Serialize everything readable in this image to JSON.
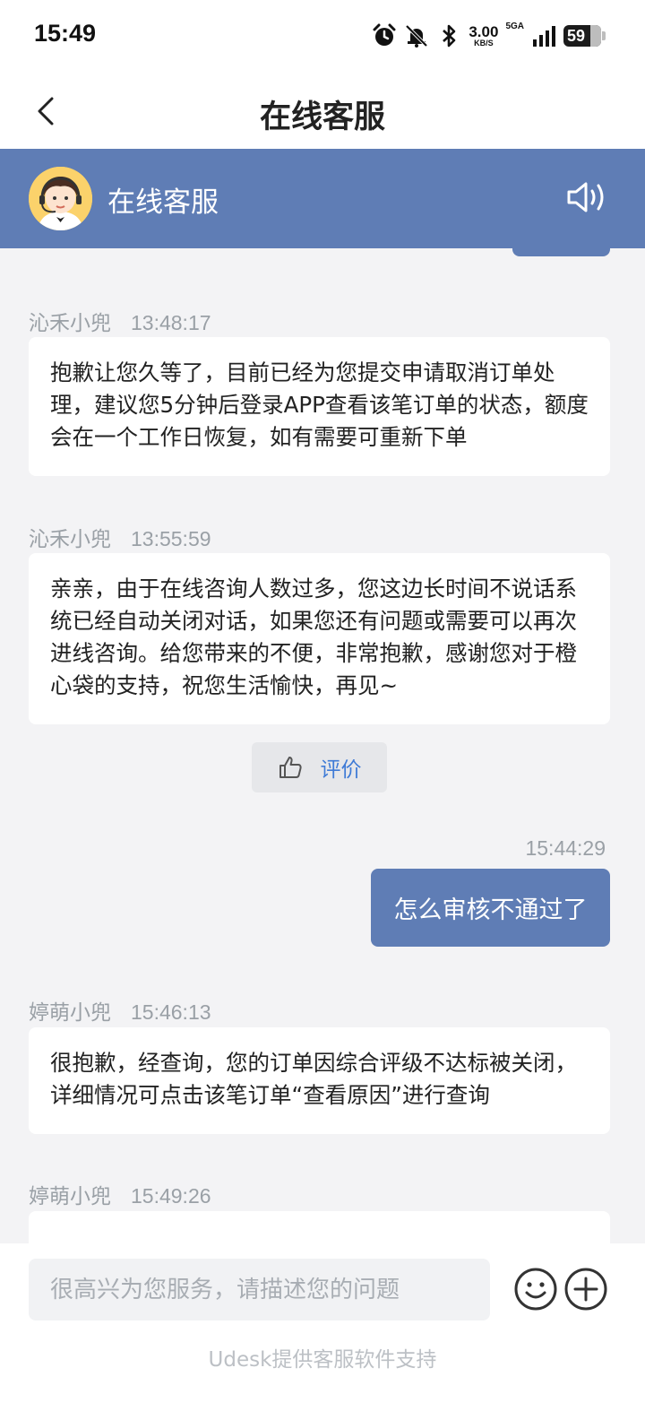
{
  "status_bar": {
    "time": "15:49",
    "net_speed": "3.00",
    "net_unit": "KB/S",
    "signal_label": "5GA",
    "battery": "59",
    "icons": [
      "alarm-icon",
      "mute-icon",
      "bluetooth-icon",
      "signal-icon",
      "battery-icon"
    ]
  },
  "nav": {
    "title": "在线客服",
    "back_icon": "chevron-left-icon"
  },
  "agent_header": {
    "name": "在线客服",
    "speaker_icon": "speaker-icon"
  },
  "messages": [
    {
      "sender": "沁禾小兜",
      "time": "13:48:17",
      "text": "抱歉让您久等了，目前已经为您提交申请取消订单处理，建议您5分钟后登录APP查看该笔订单的状态，额度会在一个工作日恢复，如有需要可重新下单"
    },
    {
      "sender": "沁禾小兜",
      "time": "13:55:59",
      "text": "亲亲，由于在线咨询人数过多，您这边长时间不说话系统已经自动关闭对话，如果您还有问题或需要可以再次进线咨询。给您带来的不便，非常抱歉，感谢您对于橙心袋的支持，祝您生活愉快，再见~"
    },
    {
      "sender": "婷萌小兜",
      "time": "15:46:13",
      "text": "很抱歉，经查询，您的订单因综合评级不达标被关闭，详细情况可点击该笔订单“查看原因”进行查询"
    },
    {
      "sender": "婷萌小兜",
      "time": "15:49:26",
      "text": ""
    }
  ],
  "rating": {
    "label": "评价"
  },
  "user_message": {
    "time": "15:44:29",
    "text": "怎么审核不通过了"
  },
  "input": {
    "placeholder": "很高兴为您服务，请描述您的问题",
    "value": ""
  },
  "footer": "Udesk提供客服软件支持",
  "colors": {
    "accent": "#5f7db5",
    "link": "#3f7bd6",
    "background": "#f3f3f5"
  }
}
